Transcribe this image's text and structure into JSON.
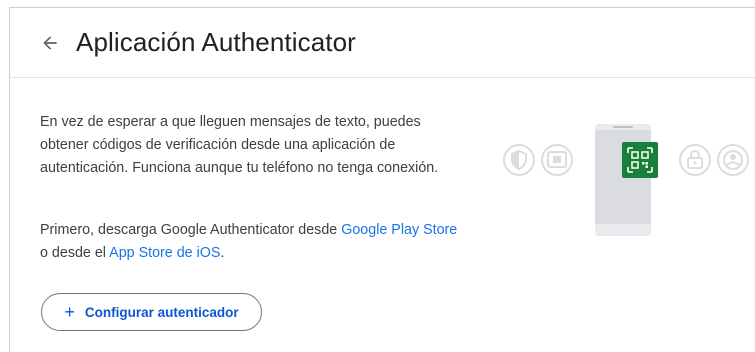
{
  "header": {
    "title": "Aplicación Authenticator"
  },
  "main": {
    "description": "En vez de esperar a que lleguen mensajes de texto, puedes obtener códigos de verificación desde una apli­cación de autenticación. Funciona aunque tu teléfono no tenga conexión.",
    "download_prefix": "Primero, descarga Google Authenticator desde ",
    "google_play_link": "Google Play Store",
    "download_middle": " o desde el ",
    "app_store_link": "App Store de iOS",
    "download_suffix": ".",
    "setup_button_label": "Configurar autenticador"
  },
  "colors": {
    "link": "#1a73e8",
    "button_text": "#0b57d0",
    "qr_green": "#188038"
  },
  "icons": {
    "back": "arrow-left",
    "setup": "plus",
    "illustration": [
      "shield-icon",
      "camera-icon",
      "qr-code-icon",
      "lock-icon",
      "account-icon"
    ]
  }
}
